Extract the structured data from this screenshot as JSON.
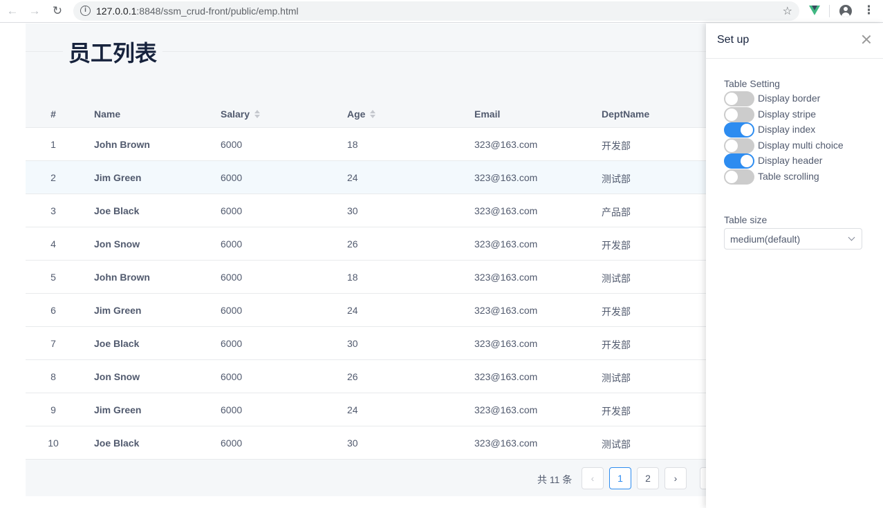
{
  "browser": {
    "url_host": "127.0.0.1",
    "url_rest": ":8848/ssm_crud-front/public/emp.html",
    "back_icon": "←",
    "forward_icon": "→",
    "reload_icon": "↻",
    "info_icon": "i",
    "star_icon": "☆",
    "menu_icon": "⋮"
  },
  "page": {
    "title": "员工列表"
  },
  "table": {
    "columns": [
      "#",
      "Name",
      "Salary",
      "Age",
      "Email",
      "DeptName"
    ],
    "rows": [
      {
        "index": "1",
        "name": "John Brown",
        "salary": "6000",
        "age": "18",
        "email": "323@163.com",
        "dept": "开发部"
      },
      {
        "index": "2",
        "name": "Jim Green",
        "salary": "6000",
        "age": "24",
        "email": "323@163.com",
        "dept": "测试部"
      },
      {
        "index": "3",
        "name": "Joe Black",
        "salary": "6000",
        "age": "30",
        "email": "323@163.com",
        "dept": "产品部"
      },
      {
        "index": "4",
        "name": "Jon Snow",
        "salary": "6000",
        "age": "26",
        "email": "323@163.com",
        "dept": "开发部"
      },
      {
        "index": "5",
        "name": "John Brown",
        "salary": "6000",
        "age": "18",
        "email": "323@163.com",
        "dept": "测试部"
      },
      {
        "index": "6",
        "name": "Jim Green",
        "salary": "6000",
        "age": "24",
        "email": "323@163.com",
        "dept": "开发部"
      },
      {
        "index": "7",
        "name": "Joe Black",
        "salary": "6000",
        "age": "30",
        "email": "323@163.com",
        "dept": "开发部"
      },
      {
        "index": "8",
        "name": "Jon Snow",
        "salary": "6000",
        "age": "26",
        "email": "323@163.com",
        "dept": "测试部"
      },
      {
        "index": "9",
        "name": "Jim Green",
        "salary": "6000",
        "age": "24",
        "email": "323@163.com",
        "dept": "开发部"
      },
      {
        "index": "10",
        "name": "Joe Black",
        "salary": "6000",
        "age": "30",
        "email": "323@163.com",
        "dept": "测试部"
      }
    ]
  },
  "pagination": {
    "total": "共 11 条",
    "prev_icon": "‹",
    "next_icon": "›",
    "pages": [
      "1",
      "2"
    ],
    "current": "1"
  },
  "drawer": {
    "title": "Set up",
    "table_setting_label": "Table Setting",
    "switches": [
      {
        "label": "Display border",
        "on": false
      },
      {
        "label": "Display stripe",
        "on": false
      },
      {
        "label": "Display index",
        "on": true
      },
      {
        "label": "Display multi choice",
        "on": false
      },
      {
        "label": "Display header",
        "on": true
      },
      {
        "label": "Table scrolling",
        "on": false
      }
    ],
    "table_size_label": "Table size",
    "table_size_value": "medium(default)"
  },
  "colors": {
    "primary": "#2d8cf0",
    "title": "#17233d",
    "text": "#515a6e",
    "border": "#e8eaec"
  }
}
